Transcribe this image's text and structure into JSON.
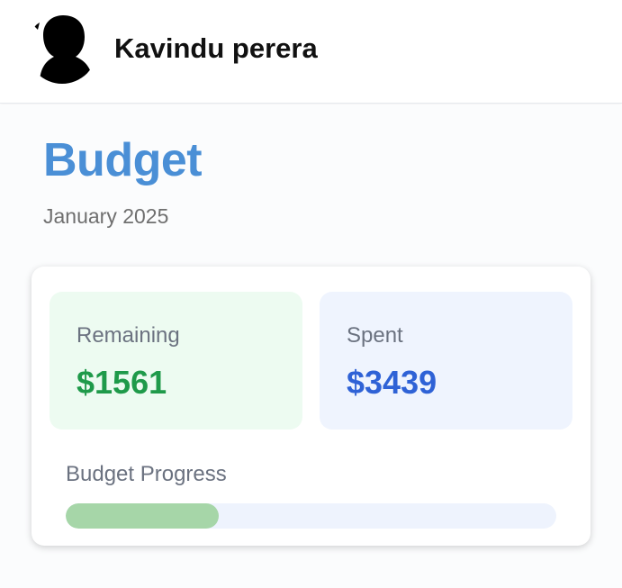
{
  "user": {
    "name": "Kavindu perera",
    "avatar_icon": "user-avatar-icon"
  },
  "page": {
    "title": "Budget",
    "period": "January 2025"
  },
  "summary": {
    "remaining": {
      "label": "Remaining",
      "value": "$1561",
      "color": "#1f9a4a"
    },
    "spent": {
      "label": "Spent",
      "value": "$3439",
      "color": "#2f62d6"
    }
  },
  "progress": {
    "label": "Budget Progress",
    "fraction": 0.312,
    "fill_color": "#a6d6a8",
    "track_color": "#eef3fd"
  },
  "colors": {
    "title": "#4a8fd6"
  }
}
